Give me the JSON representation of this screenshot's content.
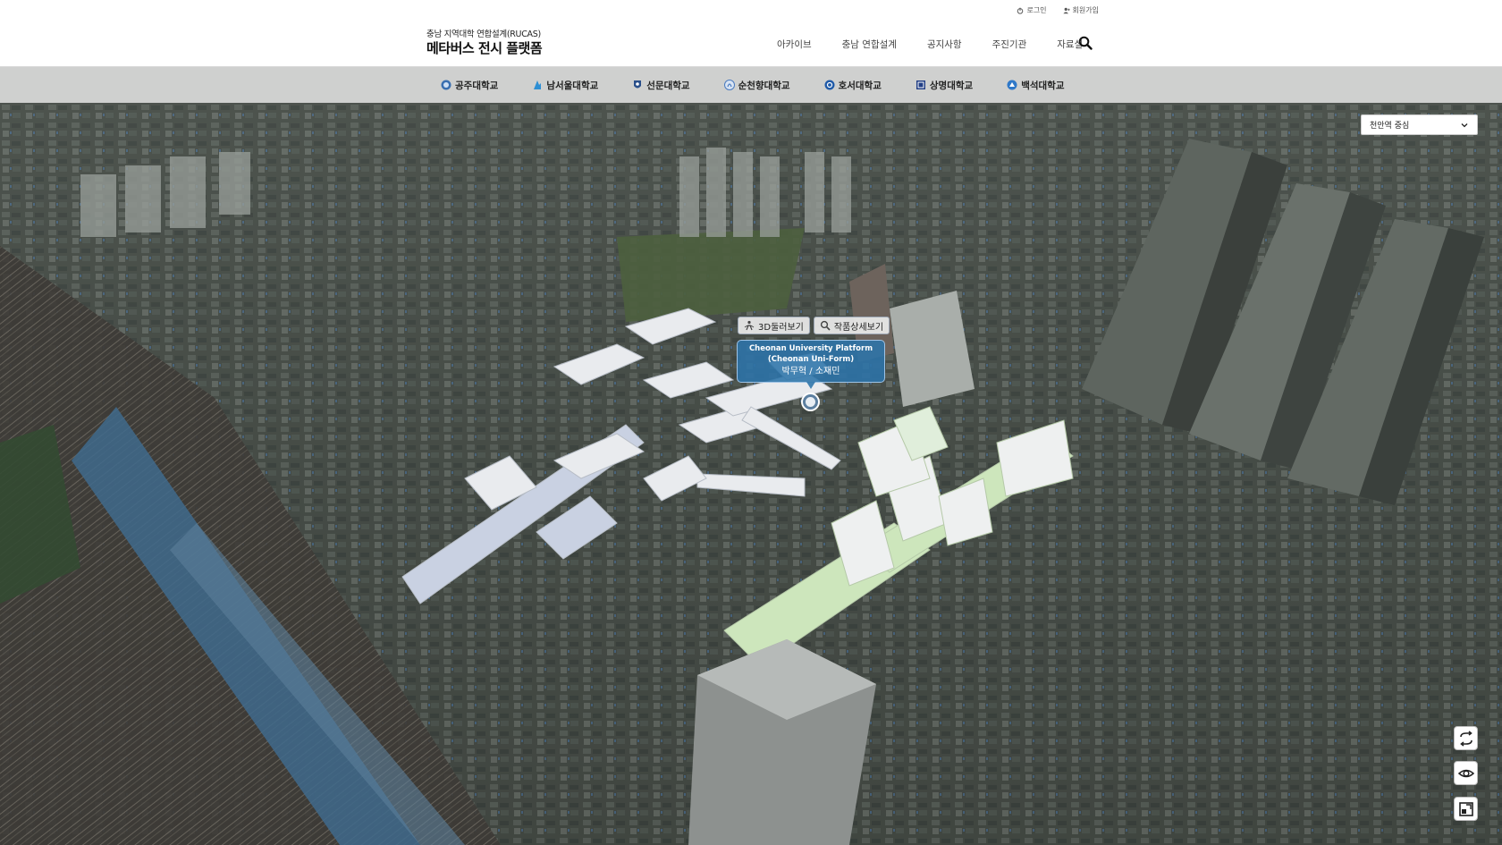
{
  "util": {
    "login": "로그인",
    "signup": "회원가입"
  },
  "logo": {
    "sub": "충남 지역대학 연합설계(RUCAS)",
    "main": "메타버스 전시 플랫폼"
  },
  "gnb": [
    "아카이브",
    "충남 연합설계",
    "공지사항",
    "주진기관",
    "자료실"
  ],
  "univs": [
    {
      "label": "공주대학교",
      "color": "#3a6fb0"
    },
    {
      "label": "남서울대학교",
      "color": "#2d8fd4"
    },
    {
      "label": "선문대학교",
      "color": "#2a4f8a"
    },
    {
      "label": "순천향대학교",
      "color": "#4a7bc0"
    },
    {
      "label": "호서대학교",
      "color": "#1f5aa8"
    },
    {
      "label": "상명대학교",
      "color": "#223f86"
    },
    {
      "label": "백석대학교",
      "color": "#2f78c8"
    }
  ],
  "location_select": {
    "value": "천안역 중심"
  },
  "popup": {
    "btn_3d": "3D둘러보기",
    "btn_detail": "작품상세보기",
    "title_line1": "Cheonan University Platform",
    "title_line2": "(Cheonan Uni-Form)",
    "authors": "박무혁 / 소재민"
  },
  "tools": [
    "rotate-icon",
    "eye-icon",
    "minimap-icon"
  ],
  "colors": {
    "popup_bg": "#2c74aa",
    "header_bg": "#ffffff",
    "tabbar_bg": "#d6d6d6"
  }
}
